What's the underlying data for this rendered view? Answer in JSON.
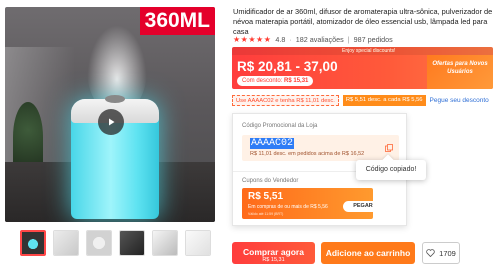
{
  "product": {
    "badge": "360ML",
    "title": "Umidificador de ar 360ml, difusor de aromaterapia ultra-sônica, pulverizador de névoa materapia portátil, atomizador de óleo essencial usb, lâmpada led para casa",
    "rating": "4.8",
    "stars": "★★★★★",
    "reviews": "182 avaliações",
    "orders": "987 pedidos"
  },
  "deal": {
    "label": "Enjoy special discounts!",
    "price_range": "R$ 20,81 - 37,00",
    "coupon_prefix": "Com desconto:",
    "coupon_value": "R$ 15,31",
    "new_users_text": "Ofertas para Novos Usuários"
  },
  "promos": {
    "code_tag": "Use AAAAC02 e tenha R$ 11,01 desc.",
    "store_tag": "R$ 5,51 desc. a cada R$ 5,56",
    "link": "Pegue seu desconto"
  },
  "store_panel": {
    "code_heading": "Código Promocional da Loja",
    "code": "AAAAC02",
    "code_desc": "R$ 11,01 desc. em pedidos acima de R$ 16,52",
    "seller_heading": "Cupons do Vendedor",
    "seller_amount": "R$ 5,51",
    "seller_condition": "Em compras de ou mais de R$ 5,56",
    "seller_validity": "Válido até 11:59 (BRT)",
    "pegar": "PEGAR"
  },
  "tooltip": "Código copiado!",
  "actions": {
    "buy_label": "Comprar agora",
    "buy_sub": "R$ 15,31",
    "cart_label": "Adicione ao carrinho",
    "wishlist_count": "1709"
  },
  "colors": {
    "accent_red": "#ff3d3d",
    "accent_orange": "#ff7a1a",
    "link_blue": "#2f6fd6"
  },
  "icons": {
    "play": "play-icon",
    "copy": "copy-icon",
    "heart": "heart-icon"
  }
}
